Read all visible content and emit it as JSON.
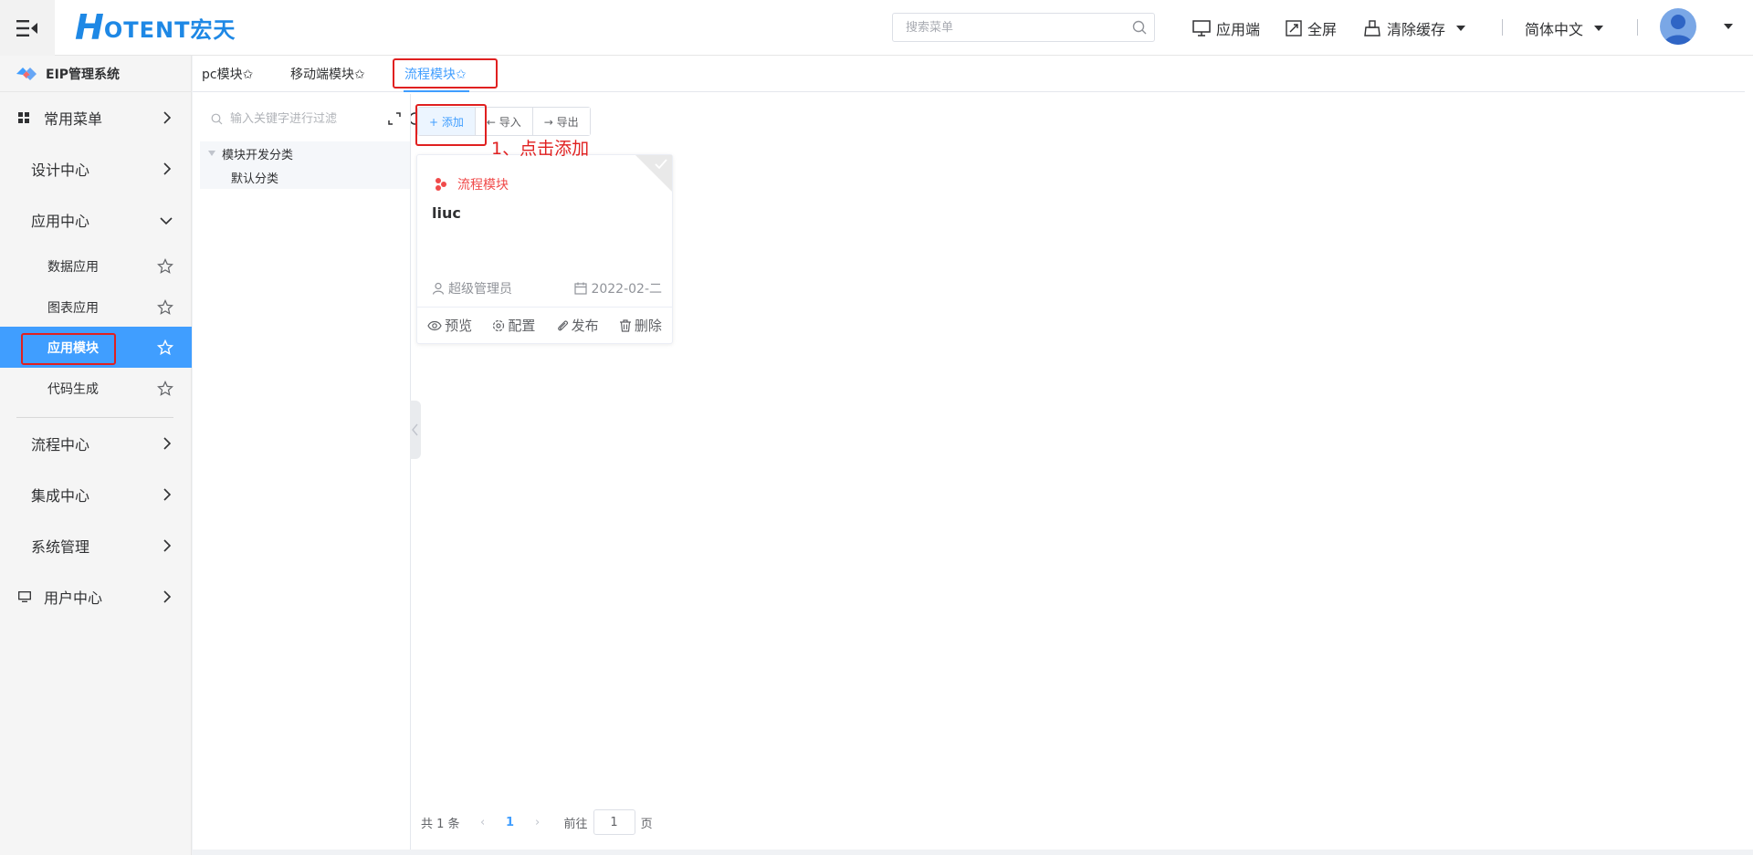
{
  "header": {
    "logo_h": "H",
    "logo_rest": "OTENT宏天",
    "search_placeholder": "搜索菜单",
    "app_side": "应用端",
    "fullscreen": "全屏",
    "clear_cache": "清除缓存",
    "language": "简体中文",
    "brand_color": "#1e88e5"
  },
  "sidebar": {
    "system_title": "EIP管理系统",
    "items": [
      {
        "label": "常用菜单"
      },
      {
        "label": "设计中心"
      },
      {
        "label": "应用中心"
      },
      {
        "label": "流程中心"
      },
      {
        "label": "集成中心"
      },
      {
        "label": "系统管理"
      },
      {
        "label": "用户中心"
      }
    ],
    "sub_items": [
      {
        "label": "数据应用"
      },
      {
        "label": "图表应用"
      },
      {
        "label": "应用模块"
      },
      {
        "label": "代码生成"
      }
    ],
    "active_color": "#409eff"
  },
  "tabs": [
    {
      "label": "pc模块✩"
    },
    {
      "label": "移动端模块✩"
    },
    {
      "label": "流程模块✩"
    }
  ],
  "tree": {
    "search_placeholder": "输入关键字进行过滤",
    "root": "模块开发分类",
    "child": "默认分类"
  },
  "toolbar": {
    "add": "+ 添加",
    "import": "← 导入",
    "export": "→ 导出"
  },
  "card": {
    "type": "流程模块",
    "name": "liuc",
    "creator": "超级管理员",
    "date": "2022-02-二",
    "actions": [
      "预览",
      "配置",
      "发布",
      "删除"
    ]
  },
  "pager": {
    "total": "共 1 条",
    "current": "1",
    "goto_prefix": "前往",
    "goto_value": "1",
    "goto_suffix": "页"
  },
  "annotation": "1、点击添加",
  "annotation_color": "#e02020"
}
